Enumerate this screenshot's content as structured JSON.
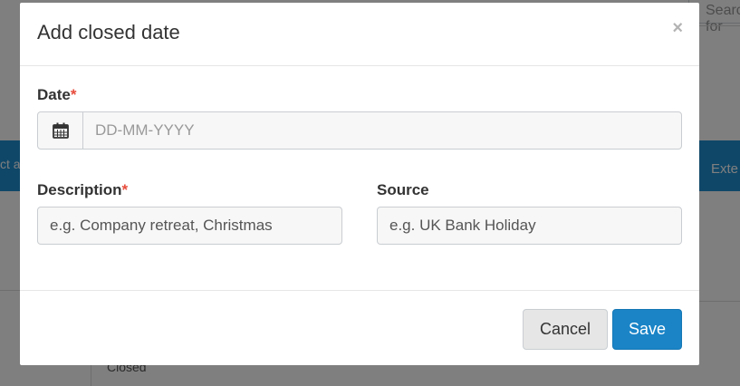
{
  "background": {
    "search_text": "Search for",
    "left_button_label": "ct a",
    "right_button_label": "Exte",
    "row_label": "Closed"
  },
  "modal": {
    "title": "Add closed date",
    "close_glyph": "×",
    "date": {
      "label": "Date",
      "required_mark": "*",
      "icon": "calendar-icon",
      "placeholder": "DD-MM-YYYY",
      "value": ""
    },
    "description": {
      "label": "Description",
      "required_mark": "*",
      "placeholder": "e.g. Company retreat, Christmas",
      "value": ""
    },
    "source": {
      "label": "Source",
      "placeholder": "e.g. UK Bank Holiday",
      "value": ""
    },
    "footer": {
      "cancel_label": "Cancel",
      "save_label": "Save"
    }
  },
  "colors": {
    "primary": "#1a84c7",
    "required": "#e74c3c",
    "header_band": "#1f8fd1"
  }
}
